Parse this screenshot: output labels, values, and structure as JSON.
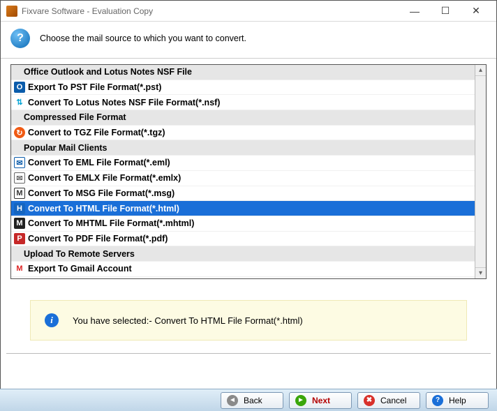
{
  "window": {
    "title": "Fixvare Software - Evaluation Copy"
  },
  "header": {
    "prompt": "Choose the mail source to which you want to convert."
  },
  "list": [
    {
      "type": "header",
      "label": "Office Outlook and Lotus Notes NSF File"
    },
    {
      "type": "item",
      "icon": "outlook",
      "label": "Export To PST File Format(*.pst)"
    },
    {
      "type": "item",
      "icon": "nsf",
      "label": "Convert To Lotus Notes NSF File Format(*.nsf)"
    },
    {
      "type": "header",
      "label": "Compressed File Format"
    },
    {
      "type": "item",
      "icon": "tgz",
      "label": "Convert to TGZ File Format(*.tgz)"
    },
    {
      "type": "header",
      "label": "Popular Mail Clients"
    },
    {
      "type": "item",
      "icon": "eml",
      "label": "Convert To EML File Format(*.eml)"
    },
    {
      "type": "item",
      "icon": "emlx",
      "label": "Convert To EMLX File Format(*.emlx)"
    },
    {
      "type": "item",
      "icon": "msg",
      "label": "Convert To MSG File Format(*.msg)"
    },
    {
      "type": "item",
      "icon": "html",
      "label": "Convert To HTML File Format(*.html)",
      "selected": true
    },
    {
      "type": "item",
      "icon": "mhtml",
      "label": "Convert To MHTML File Format(*.mhtml)"
    },
    {
      "type": "item",
      "icon": "pdf",
      "label": "Convert To PDF File Format(*.pdf)"
    },
    {
      "type": "header",
      "label": "Upload To Remote Servers"
    },
    {
      "type": "item",
      "icon": "gmail",
      "label": "Export To Gmail Account"
    }
  ],
  "info": {
    "message": "You have selected:- Convert To HTML File Format(*.html)"
  },
  "buttons": {
    "back": "Back",
    "next": "Next",
    "cancel": "Cancel",
    "help": "Help"
  },
  "icon_glyphs": {
    "outlook": "O",
    "nsf": "⇅",
    "tgz": "↻",
    "eml": "✉",
    "emlx": "✉",
    "msg": "M",
    "html": "H",
    "mhtml": "M",
    "pdf": "P",
    "gmail": "M"
  }
}
